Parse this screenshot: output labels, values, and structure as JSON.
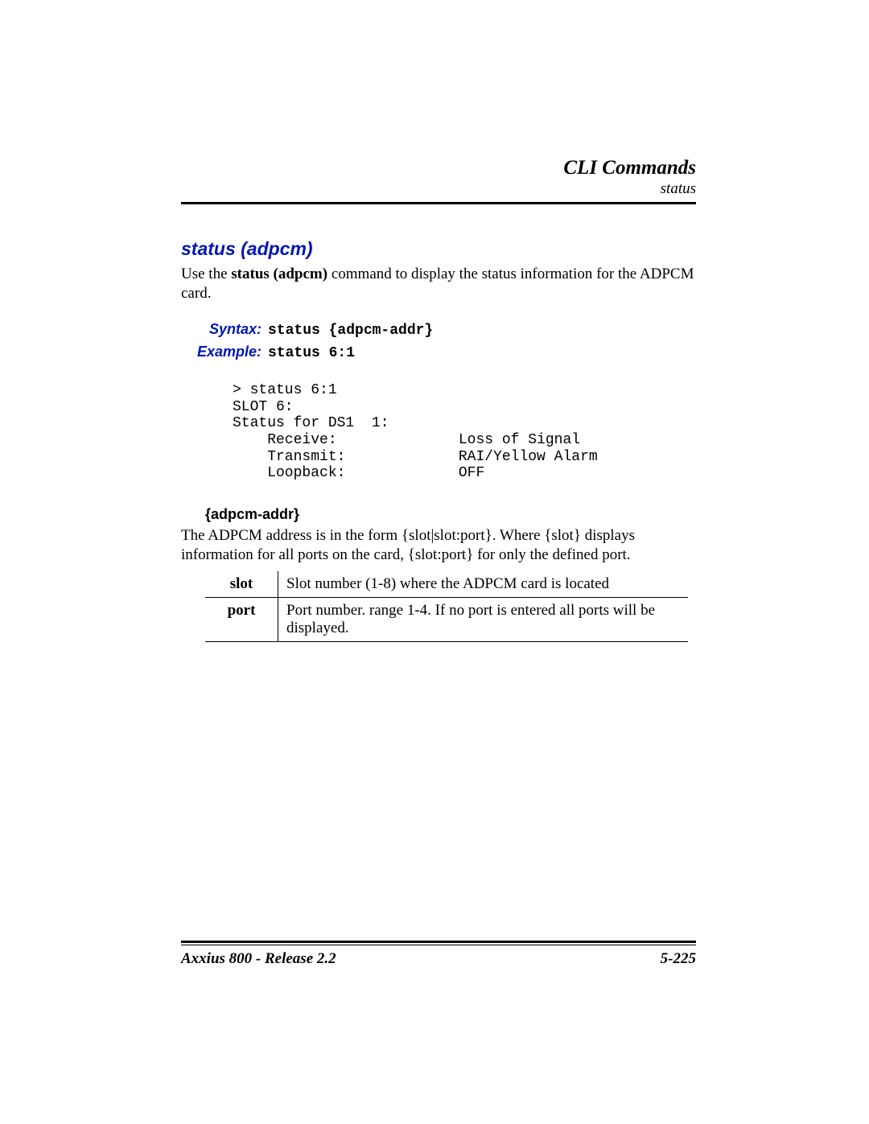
{
  "header": {
    "chapter": "CLI Commands",
    "section": "status"
  },
  "command": {
    "title": "status (adpcm)",
    "intro_pre": "Use the ",
    "intro_bold": "status (adpcm)",
    "intro_post": " command to display the status information for the ADPCM card."
  },
  "syntax": {
    "label": "Syntax:",
    "value": "status {adpcm-addr}"
  },
  "example": {
    "label": "Example:",
    "value": "status 6:1"
  },
  "terminal": "> status 6:1\nSLOT 6:\nStatus for DS1  1:\n    Receive:              Loss of Signal\n    Transmit:             RAI/Yellow Alarm\n    Loopback:             OFF",
  "param": {
    "heading": "{adpcm-addr}",
    "description": "The ADPCM address is in the form {slot|slot:port}. Where {slot} displays information for all ports on the card, {slot:port} for only the defined port.",
    "rows": [
      {
        "name": "slot",
        "desc": "Slot number (1-8) where the ADPCM card is located"
      },
      {
        "name": "port",
        "desc": "Port number. range 1-4. If no port is entered all ports will be displayed."
      }
    ]
  },
  "footer": {
    "left": "Axxius 800 - Release 2.2",
    "right": "5-225"
  }
}
